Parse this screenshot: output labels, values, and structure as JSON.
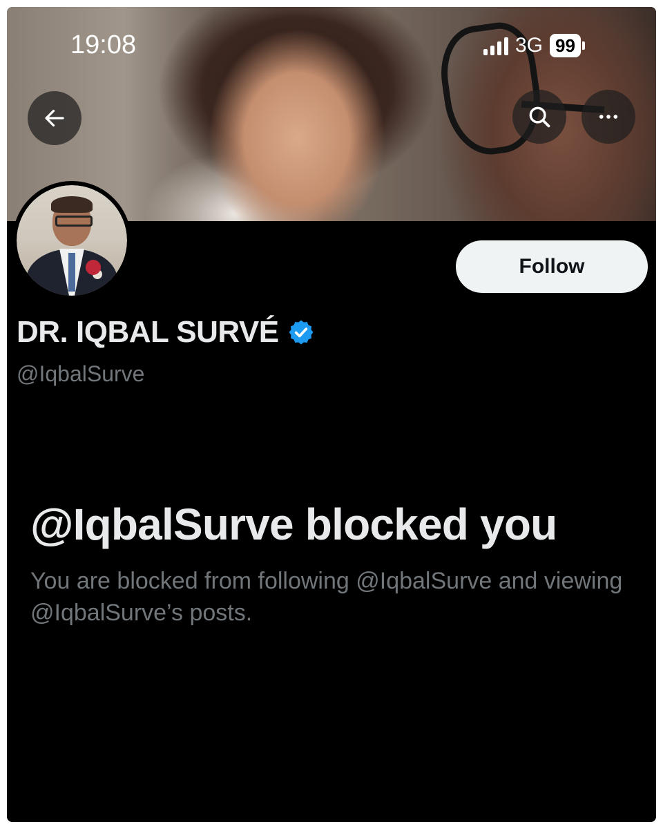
{
  "status_bar": {
    "time": "19:08",
    "network": "3G",
    "battery": "99"
  },
  "header": {
    "back_icon": "arrow-left-icon",
    "search_icon": "search-icon",
    "more_icon": "more-horizontal-icon"
  },
  "profile": {
    "display_name": "DR. IQBAL SURVÉ",
    "handle": "@IqbalSurve",
    "verified": true,
    "verified_color": "#1d9bf0",
    "follow_label": "Follow"
  },
  "blocked": {
    "title": "@IqbalSurve blocked you",
    "description": "You are blocked from following @IqbalSurve and viewing @IqbalSurve’s posts."
  },
  "colors": {
    "background": "#000000",
    "primary_text": "#e7e9ea",
    "secondary_text": "#71767b",
    "follow_button_bg": "#eff3f4"
  }
}
